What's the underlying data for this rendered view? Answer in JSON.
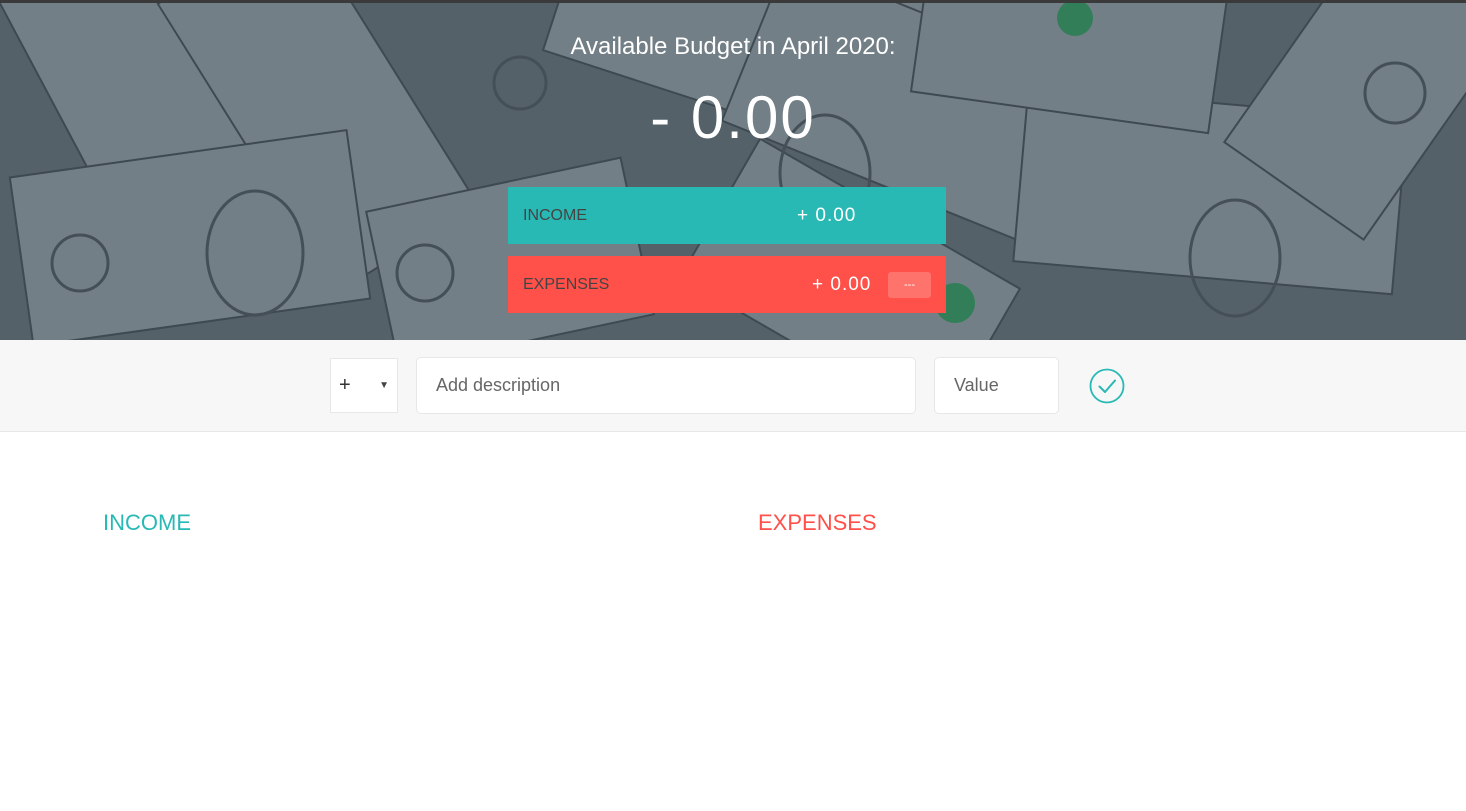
{
  "header": {
    "budget_title": "Available Budget in April 2020:",
    "budget_value": "- 0.00",
    "income_label": "INCOME",
    "income_value": "+ 0.00",
    "expenses_label": "EXPENSES",
    "expenses_value": "+ 0.00",
    "expenses_percentage": "---"
  },
  "add_form": {
    "type_selected": "+",
    "description_placeholder": "Add description",
    "value_placeholder": "Value",
    "submit_icon": "check-circle-icon"
  },
  "lists": {
    "income_title": "INCOME",
    "expenses_title": "EXPENSES"
  },
  "colors": {
    "income": "#28b9b5",
    "expenses": "#ff5049"
  }
}
